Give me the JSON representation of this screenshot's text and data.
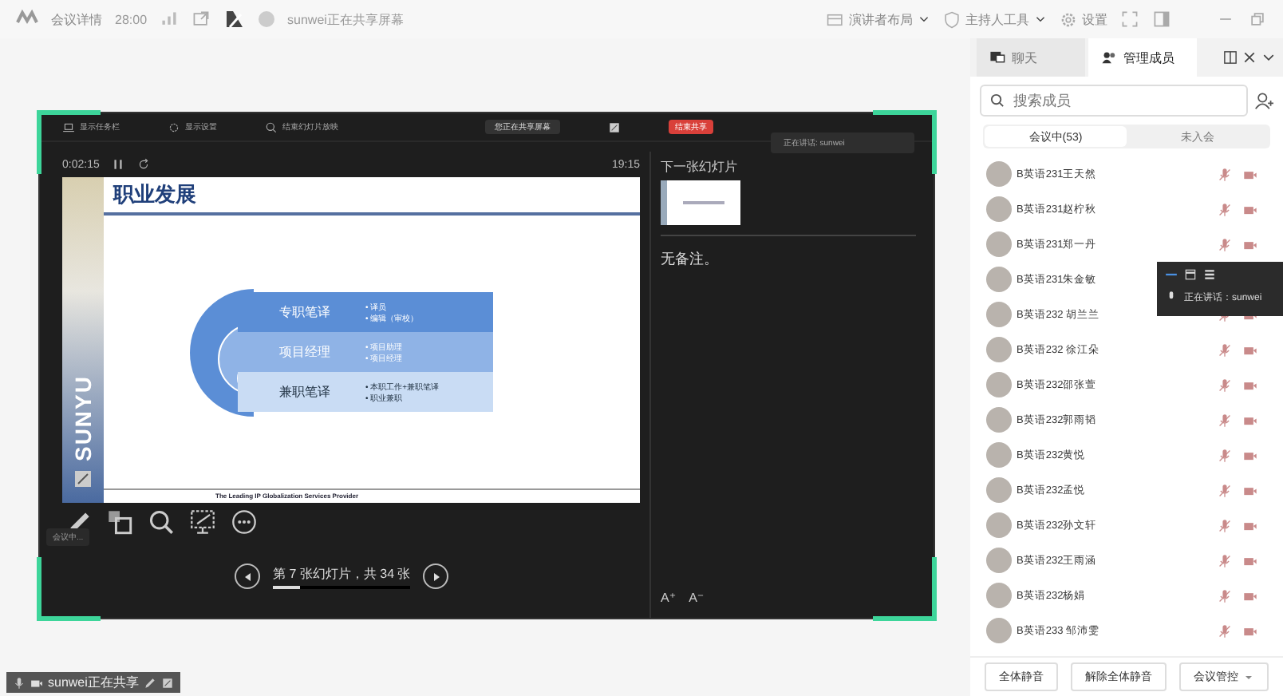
{
  "top_bar": {
    "meeting_info": "会议详情",
    "duration": "28:00",
    "sharing_notice": "sunwei正在共享屏幕",
    "menus": [
      {
        "label": "演讲者布局",
        "kind": "dropdown"
      },
      {
        "label": "主持人工具",
        "kind": "dropdown"
      },
      {
        "label": "设置",
        "kind": "plain"
      }
    ]
  },
  "shared_screen": {
    "toolbar": [
      "显示任务栏",
      "显示设置",
      "结束幻灯片放映"
    ],
    "share_pill": "您正在共享屏幕",
    "stop_share": "结束共享",
    "speaking": "正在讲话: sunwei",
    "elapsed": "0:02:15",
    "clock": "19:15",
    "slide": {
      "title": "职业发展",
      "logo": "SUNYU",
      "footer": "The Leading IP Globalization Services Provider",
      "rows": [
        {
          "label": "专职笔译",
          "bullets": [
            "• 译员",
            "• 编辑（审校）"
          ]
        },
        {
          "label": "项目经理",
          "bullets": [
            "• 项目助理",
            "• 项目经理"
          ]
        },
        {
          "label": "兼职笔译",
          "bullets": [
            "• 本职工作+兼职笔译",
            "• 职业兼职"
          ]
        }
      ]
    },
    "next_label": "下一张幻灯片",
    "notes": "无备注。",
    "font_buttons": [
      "A⁺",
      "A⁻"
    ],
    "tag": "会议中...",
    "slide_counter": "第 7 张幻灯片，共 34 张",
    "progress": {
      "level": 0.2
    }
  },
  "status_bar": {
    "text": "sunwei正在共享"
  },
  "side_panel": {
    "tabs": [
      {
        "label": "聊天",
        "selected": false
      },
      {
        "label": "管理成员",
        "selected": true
      }
    ],
    "search": {
      "placeholder": "搜索成员"
    },
    "segments": [
      {
        "label": "会议中(53)",
        "selected": true
      },
      {
        "label": "未入会",
        "selected": false
      }
    ],
    "members": [
      {
        "name": "B英语231王天然"
      },
      {
        "name": "B英语231赵柠秋"
      },
      {
        "name": "B英语231郑一丹"
      },
      {
        "name": "B英语231朱金敏"
      },
      {
        "name": "B英语232 胡兰兰"
      },
      {
        "name": "B英语232 徐江朵"
      },
      {
        "name": "B英语232邵张萱"
      },
      {
        "name": "B英语232郭雨韬"
      },
      {
        "name": "B英语232黄悦"
      },
      {
        "name": "B英语232孟悦"
      },
      {
        "name": "B英语232孙文轩"
      },
      {
        "name": "B英语232王雨涵"
      },
      {
        "name": "B英语232杨娟"
      },
      {
        "name": "B英语233 邹沛雯"
      }
    ],
    "speaker_popup": {
      "text": "正在讲话：sunwei"
    },
    "buttons": [
      {
        "label": "全体静音",
        "kind": "plain"
      },
      {
        "label": "解除全体静音",
        "kind": "plain"
      },
      {
        "label": "会议管控",
        "kind": "dropdown"
      }
    ]
  }
}
